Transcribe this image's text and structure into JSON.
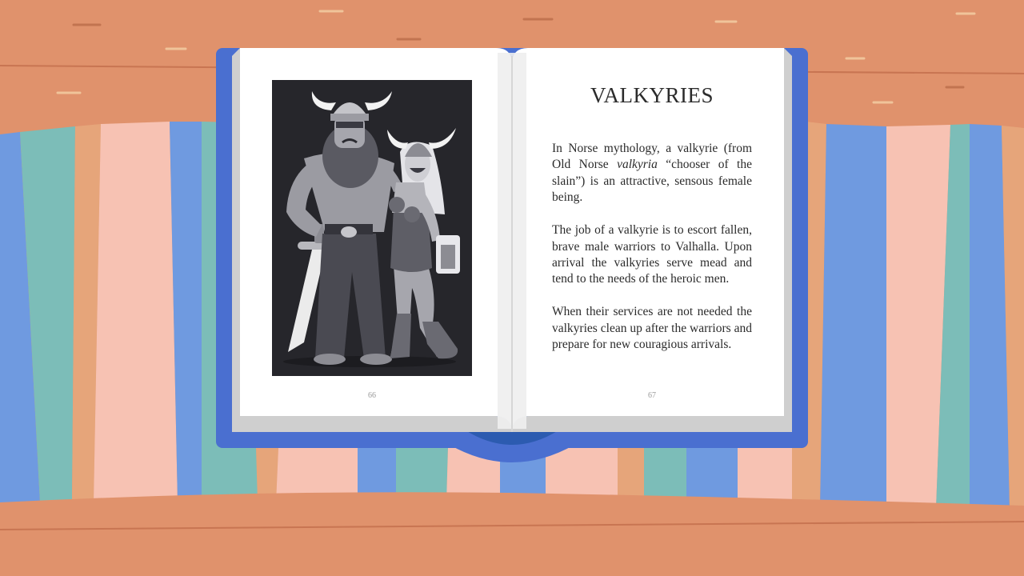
{
  "book": {
    "title": "VALKYRIES",
    "left_page_number": "66",
    "right_page_number": "67",
    "paragraphs": {
      "p1_a": "In Norse mythology, a valkyrie (from Old Norse ",
      "p1_italic": "valkyria",
      "p1_b": " “chooser of the slain”) is an attractive, sensous female being.",
      "p2": "The job of a valkyrie is to escort fallen, brave male warriors to Valhalla. Upon arrival the valkyries serve mead and tend to the needs of the heroic men.",
      "p3": "When their services are not needed the valkyries clean up after the warriors and prepare for new couragious arrivals."
    },
    "illustration": {
      "subject": "viking-warrior-and-valkyrie-illustration",
      "palette": {
        "bg": "#26262b",
        "figure": "#8c8c93",
        "light": "#d6d6da",
        "horn": "#f2f2f2"
      }
    }
  },
  "colors": {
    "table": "#e0926c",
    "book_cover": "#4a6fd0",
    "page": "#ffffff",
    "text": "#2b2b2b"
  }
}
